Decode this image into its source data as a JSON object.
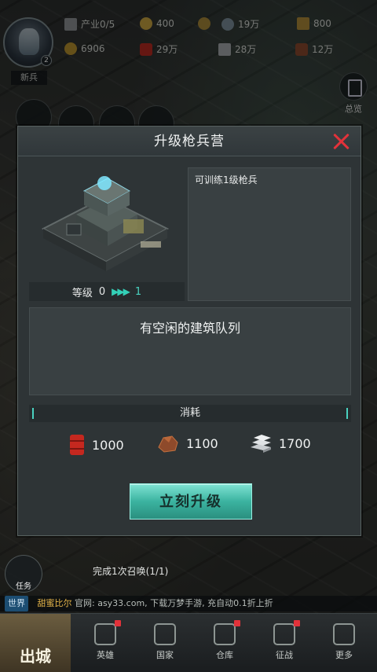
{
  "topbar": {
    "industry": "产业0/5",
    "gold": "400",
    "power": "19万",
    "crates": "800",
    "energy": "6906",
    "oil": "29万",
    "steel": "28万",
    "ore": "12万"
  },
  "player": {
    "rank": "新兵",
    "level": "2"
  },
  "overview_label": "总览",
  "modal": {
    "title": "升级枪兵营",
    "level_label": "等级",
    "level_current": "0",
    "level_next": "1",
    "description": "可训练1级枪兵",
    "queue_message": "有空闲的建筑队列",
    "cost_title": "消耗",
    "costs": [
      {
        "icon": "oil-barrel-icon",
        "value": "1000"
      },
      {
        "icon": "ore-icon",
        "value": "1100"
      },
      {
        "icon": "steel-ingot-icon",
        "value": "1700"
      }
    ],
    "upgrade_label": "立刻升级"
  },
  "task": {
    "label": "任务",
    "text": "完成1次召唤",
    "progress": "(1/1)"
  },
  "chat": {
    "channel": "世界",
    "user": "甜蜜比尔",
    "message": "官网: asy33.com, 下载万梦手游, 充自动0.1折上折"
  },
  "bottom": {
    "go_out": "出城",
    "tabs": [
      "英雄",
      "国家",
      "仓库",
      "征战",
      "更多"
    ]
  },
  "colors": {
    "accent": "#4ad2c0",
    "close": "#e2323a",
    "button": "#3bb3a0"
  }
}
